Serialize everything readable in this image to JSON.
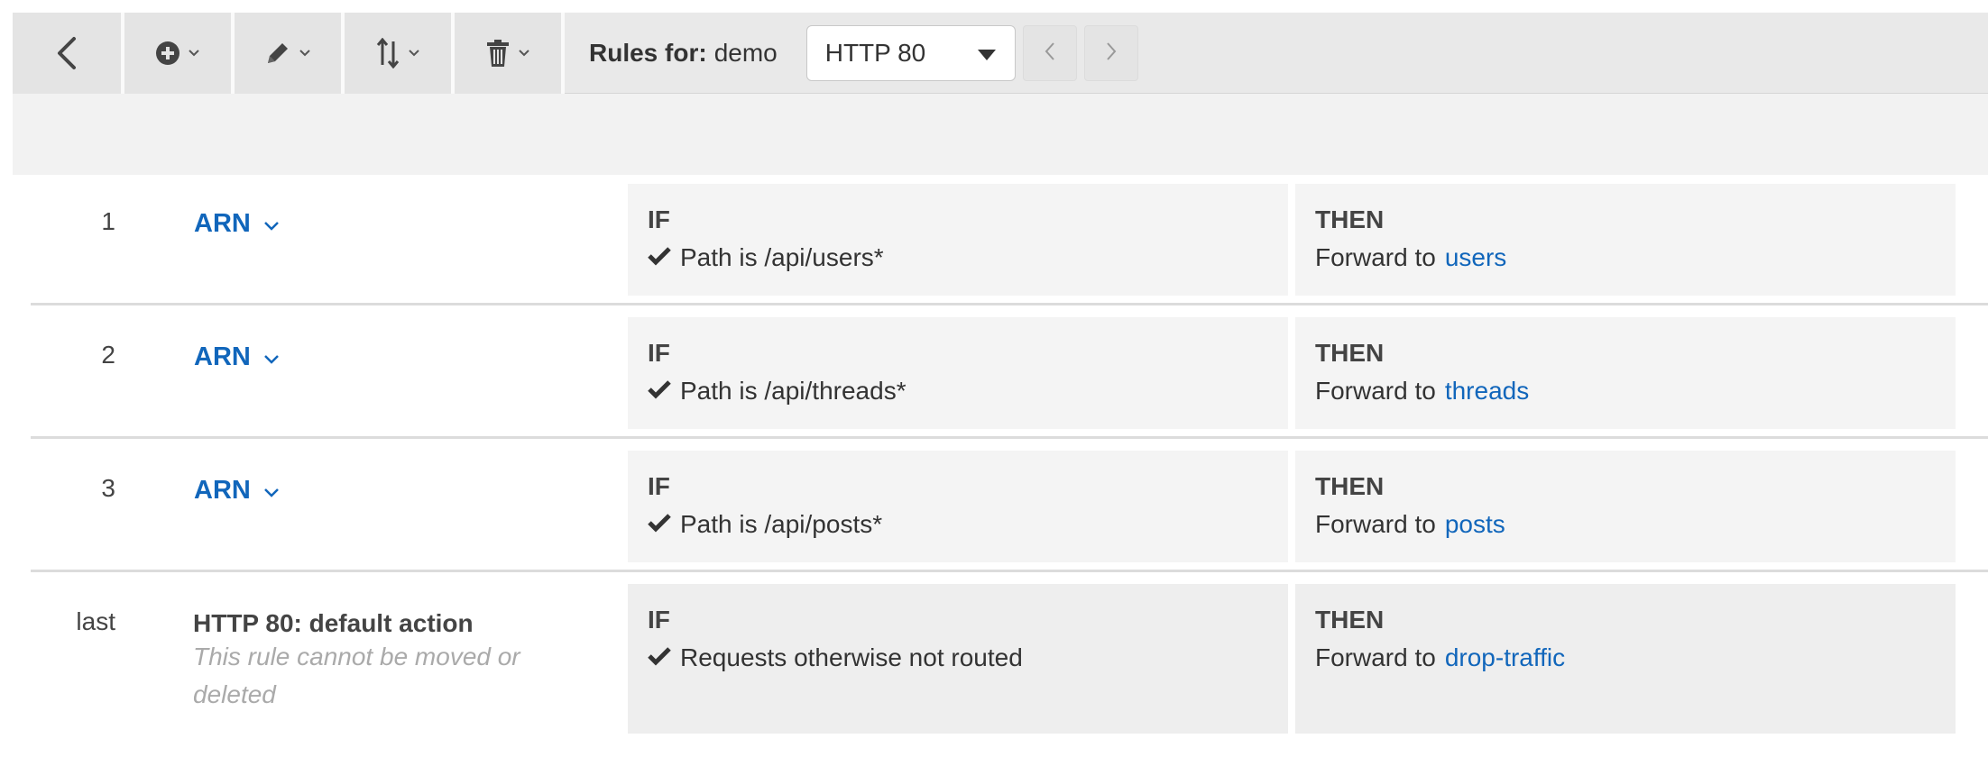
{
  "toolbar": {
    "back_icon": "chevron-left-icon",
    "add_icon": "plus-circle-icon",
    "edit_icon": "pencil-icon",
    "reorder_icon": "sort-arrows-icon",
    "delete_icon": "trash-icon",
    "rules_for_label": "Rules for:",
    "load_balancer_name": "demo",
    "listener_selected": "HTTP 80"
  },
  "rules": [
    {
      "priority": "1",
      "arn_label": "ARN",
      "if_label": "IF",
      "condition": "Path is /api/users*",
      "then_label": "THEN",
      "action_prefix": "Forward to",
      "target": "users"
    },
    {
      "priority": "2",
      "arn_label": "ARN",
      "if_label": "IF",
      "condition": "Path is /api/threads*",
      "then_label": "THEN",
      "action_prefix": "Forward to",
      "target": "threads"
    },
    {
      "priority": "3",
      "arn_label": "ARN",
      "if_label": "IF",
      "condition": "Path is /api/posts*",
      "then_label": "THEN",
      "action_prefix": "Forward to",
      "target": "posts"
    }
  ],
  "default_rule": {
    "priority": "last",
    "title": "HTTP 80: default action",
    "note": "This rule cannot be moved or deleted",
    "if_label": "IF",
    "condition": "Requests otherwise not routed",
    "then_label": "THEN",
    "action_prefix": "Forward to",
    "target": "drop-traffic"
  },
  "colors": {
    "link": "#1166bb",
    "toolbar_bg": "#e9e9e9",
    "box_bg": "#f4f4f4"
  }
}
